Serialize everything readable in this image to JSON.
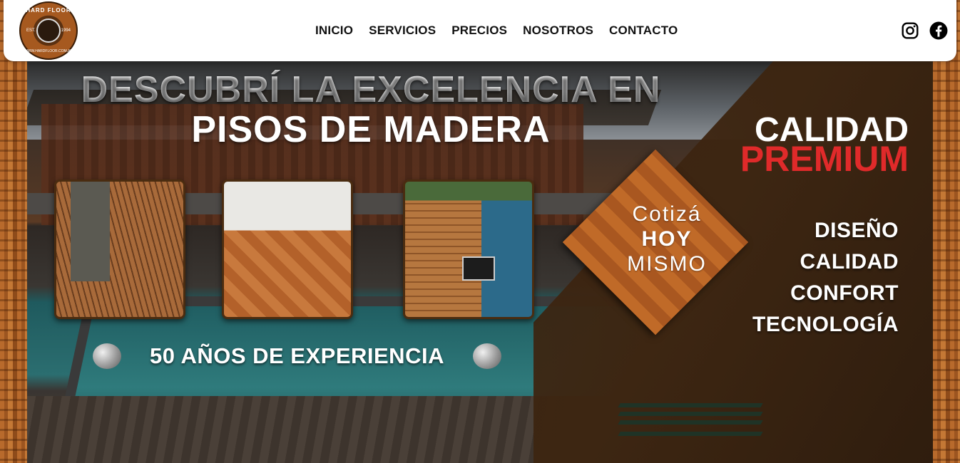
{
  "logo": {
    "ring_text": "HARD FLOOR",
    "est": "EST.",
    "year": "1994",
    "url": "WWW.HARDFLOOR.COM.AR"
  },
  "nav": {
    "items": [
      {
        "label": "INICIO"
      },
      {
        "label": "SERVICIOS"
      },
      {
        "label": "PRECIOS"
      },
      {
        "label": "NOSOTROS"
      },
      {
        "label": "CONTACTO"
      }
    ]
  },
  "social": {
    "instagram_icon": "instagram-icon",
    "facebook_icon": "facebook-icon"
  },
  "hero": {
    "headline_line1": "DESCUBRÍ LA EXCELENCIA EN",
    "headline_line2": "PISOS DE MADERA",
    "experience": "50 AÑOS DE EXPERIENCIA",
    "cta_line1": "Cotizá",
    "cta_line2": "HOY",
    "cta_line3": "MISMO",
    "calidad": "CALIDAD",
    "premium": "PREMIUM",
    "features": [
      "DISEÑO",
      "CALIDAD",
      "CONFORT",
      "TECNOLOGÍA"
    ]
  },
  "colors": {
    "premium_red": "#e02a2a",
    "wood": "#b8642a",
    "header_bg": "#ffffff"
  }
}
